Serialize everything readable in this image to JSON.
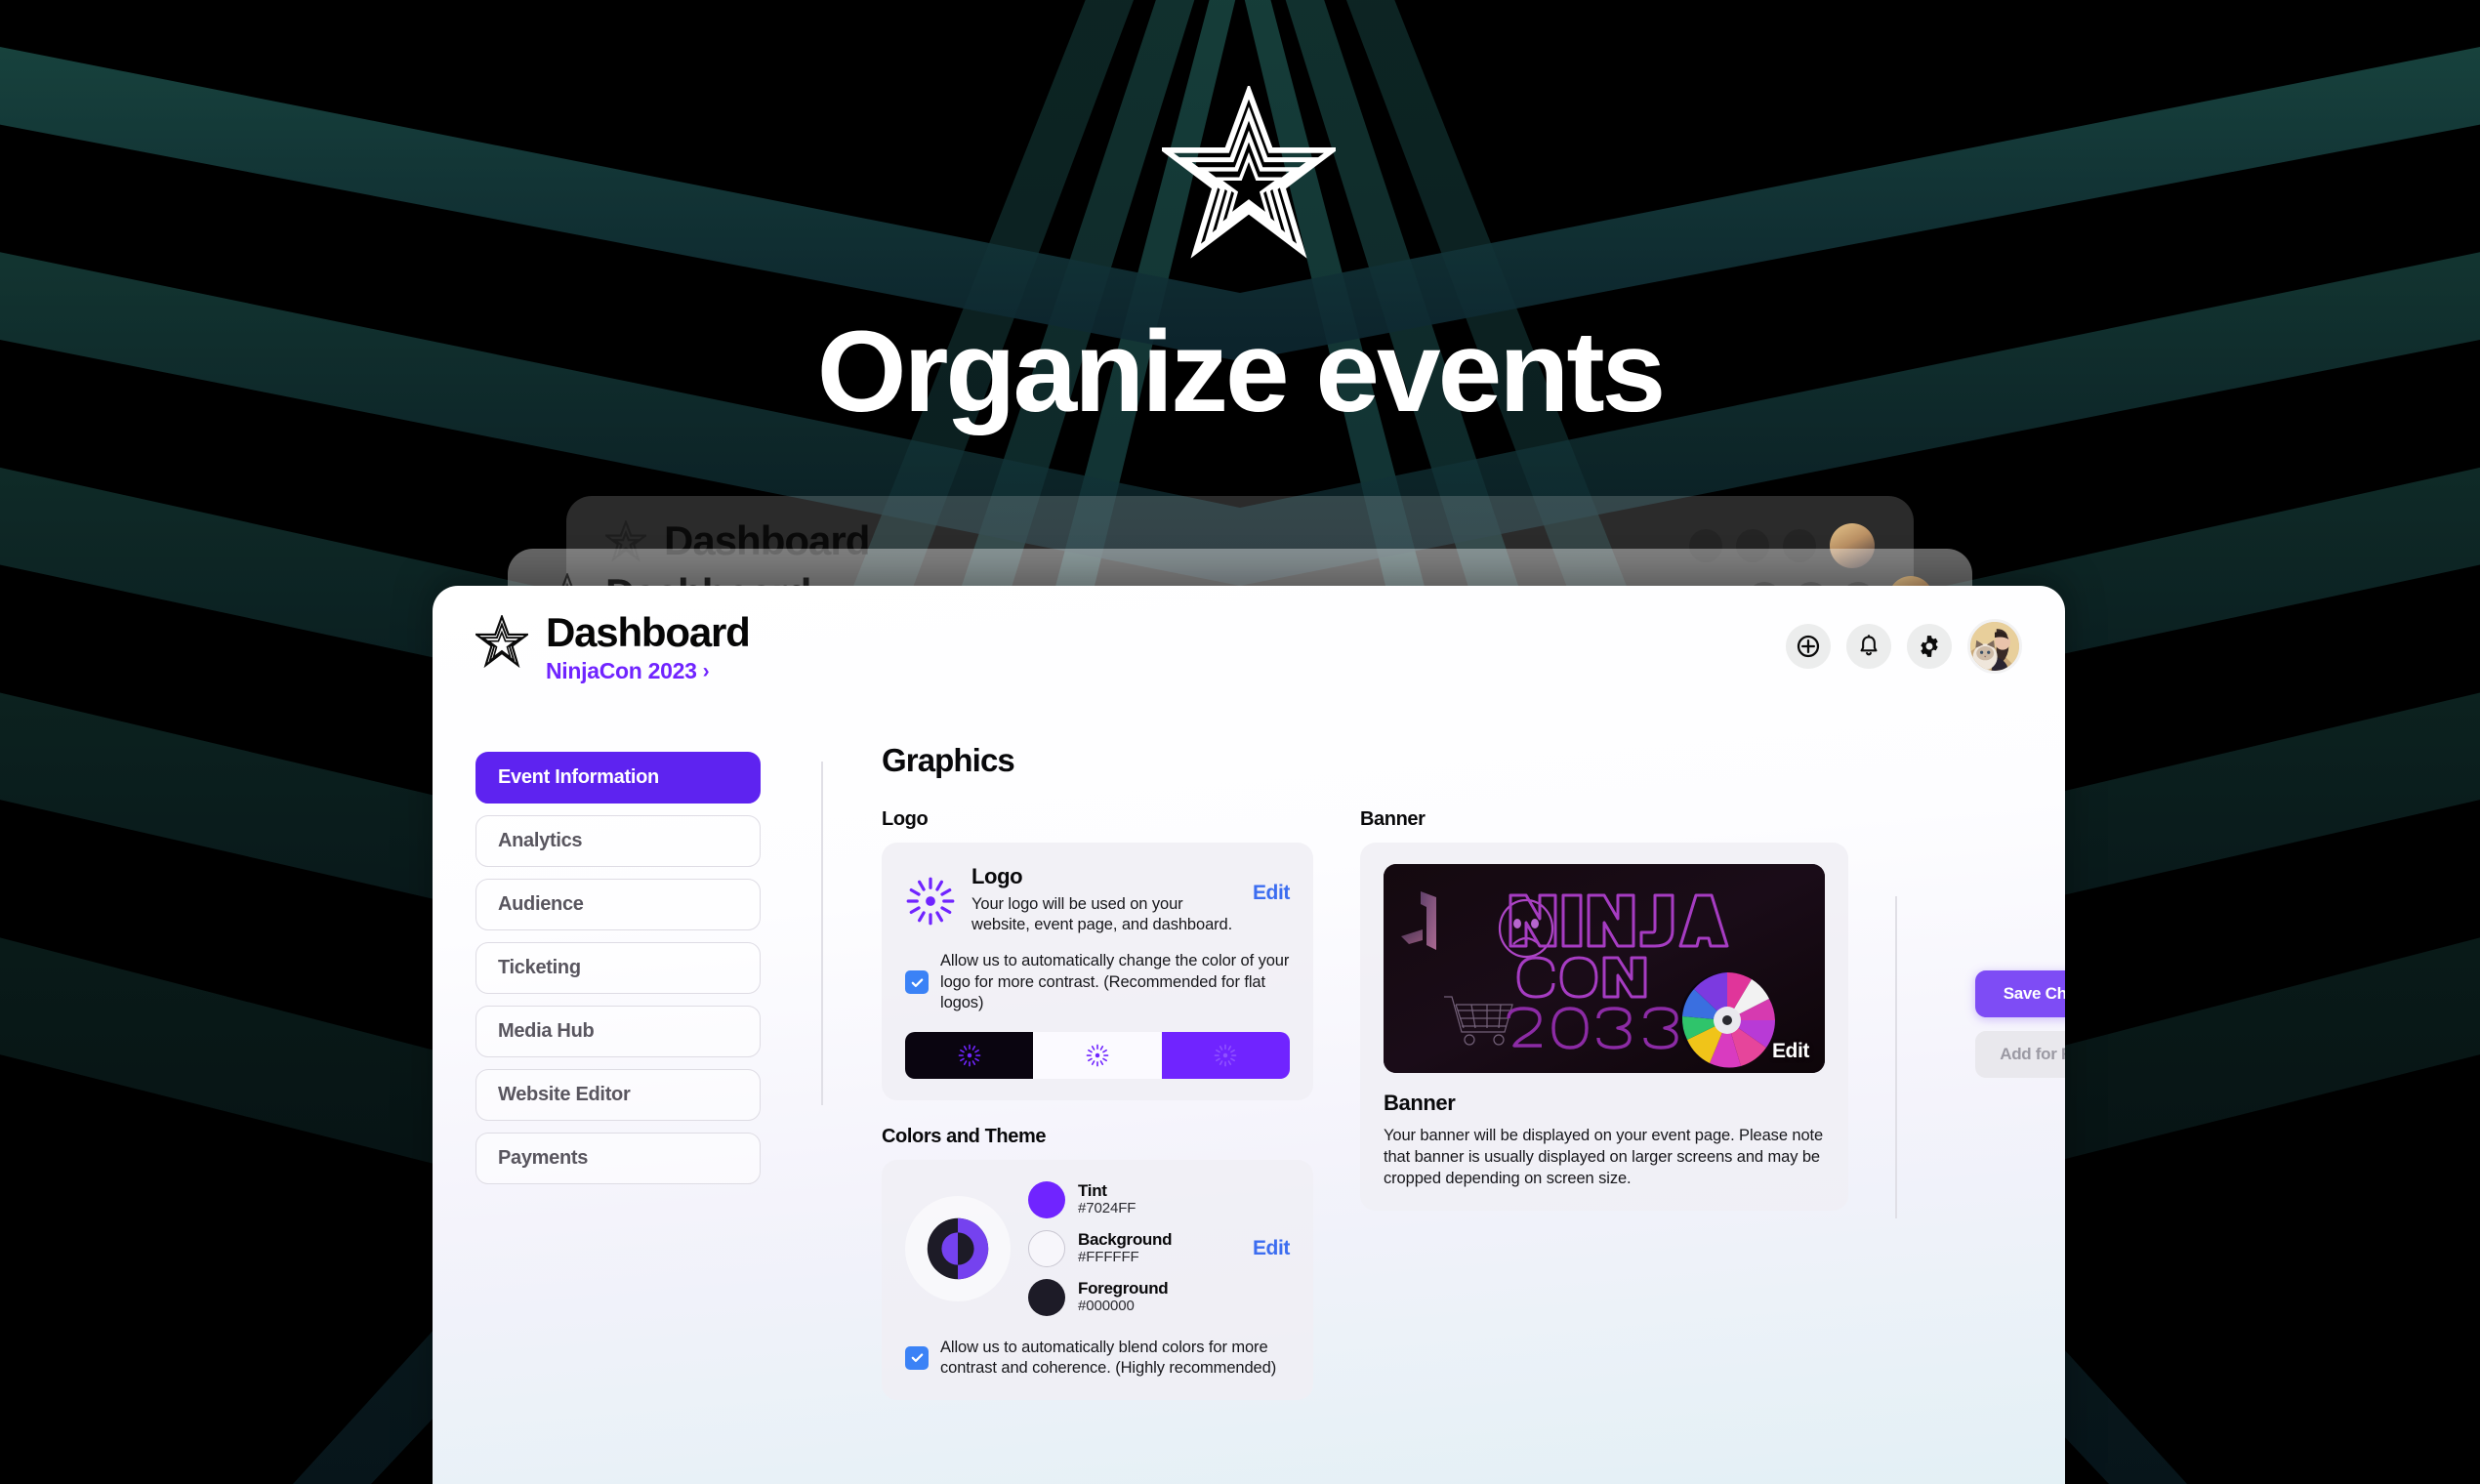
{
  "hero": {
    "title": "Organize events",
    "logo_icon": "nested-star-icon",
    "background_color": "#000000",
    "stripe_color": "#143a3a"
  },
  "ghost_cards": [
    {
      "title": "Dashboard"
    },
    {
      "title": "Dashboard"
    }
  ],
  "header": {
    "logo_icon": "nested-star-icon",
    "title": "Dashboard",
    "event_name": "NinjaCon 2023",
    "event_chevron": "›",
    "actions": [
      {
        "name": "add-circle-icon",
        "label": "Add"
      },
      {
        "name": "bell-icon",
        "label": "Notifications"
      },
      {
        "name": "gear-icon",
        "label": "Settings"
      }
    ],
    "avatar_label": "User avatar"
  },
  "sidebar": {
    "items": [
      {
        "label": "Event Information",
        "active": true
      },
      {
        "label": "Analytics",
        "active": false
      },
      {
        "label": "Audience",
        "active": false
      },
      {
        "label": "Ticketing",
        "active": false
      },
      {
        "label": "Media Hub",
        "active": false
      },
      {
        "label": "Website Editor",
        "active": false
      },
      {
        "label": "Payments",
        "active": false
      }
    ]
  },
  "main": {
    "page_title": "Graphics",
    "logo_section": {
      "label": "Logo",
      "card_title": "Logo",
      "card_description": "Your logo will be used on your website, event page, and dashboard.",
      "edit_label": "Edit",
      "checkbox_checked": true,
      "checkbox_text": "Allow us to automatically change the color of your logo for more contrast. (Recommended for flat logos)",
      "previews": [
        {
          "name": "preview-dark",
          "background": "#0a0510"
        },
        {
          "name": "preview-light",
          "background": "#fbfaff"
        },
        {
          "name": "preview-tint",
          "background": "#7024FF"
        }
      ]
    },
    "colors_section": {
      "label": "Colors and Theme",
      "edit_label": "Edit",
      "swatches": [
        {
          "name": "Tint",
          "hex": "#7024FF"
        },
        {
          "name": "Background",
          "hex": "#FFFFFF"
        },
        {
          "name": "Foreground",
          "hex": "#000000"
        }
      ],
      "checkbox_checked": true,
      "checkbox_text": "Allow us to automatically blend colors for more contrast and coherence. (Highly recommended)"
    },
    "banner_section": {
      "label": "Banner",
      "edit_label": "Edit",
      "card_title": "Banner",
      "card_description": "Your banner will be displayed on your event page. Please note that banner is usually displayed on larger screens and may be cropped depending on screen size.",
      "image_alt": "NINJA CON 2023 neon banner"
    }
  },
  "actions_rail": {
    "save_label": "Save Changes",
    "review_label": "Add for Review"
  },
  "colors": {
    "accent": "#7024FF",
    "nav_active": "#5E23F0",
    "edit_link": "#3C6DF0",
    "checkbox": "#3B82F6",
    "save_button": "#7E4CF5"
  }
}
